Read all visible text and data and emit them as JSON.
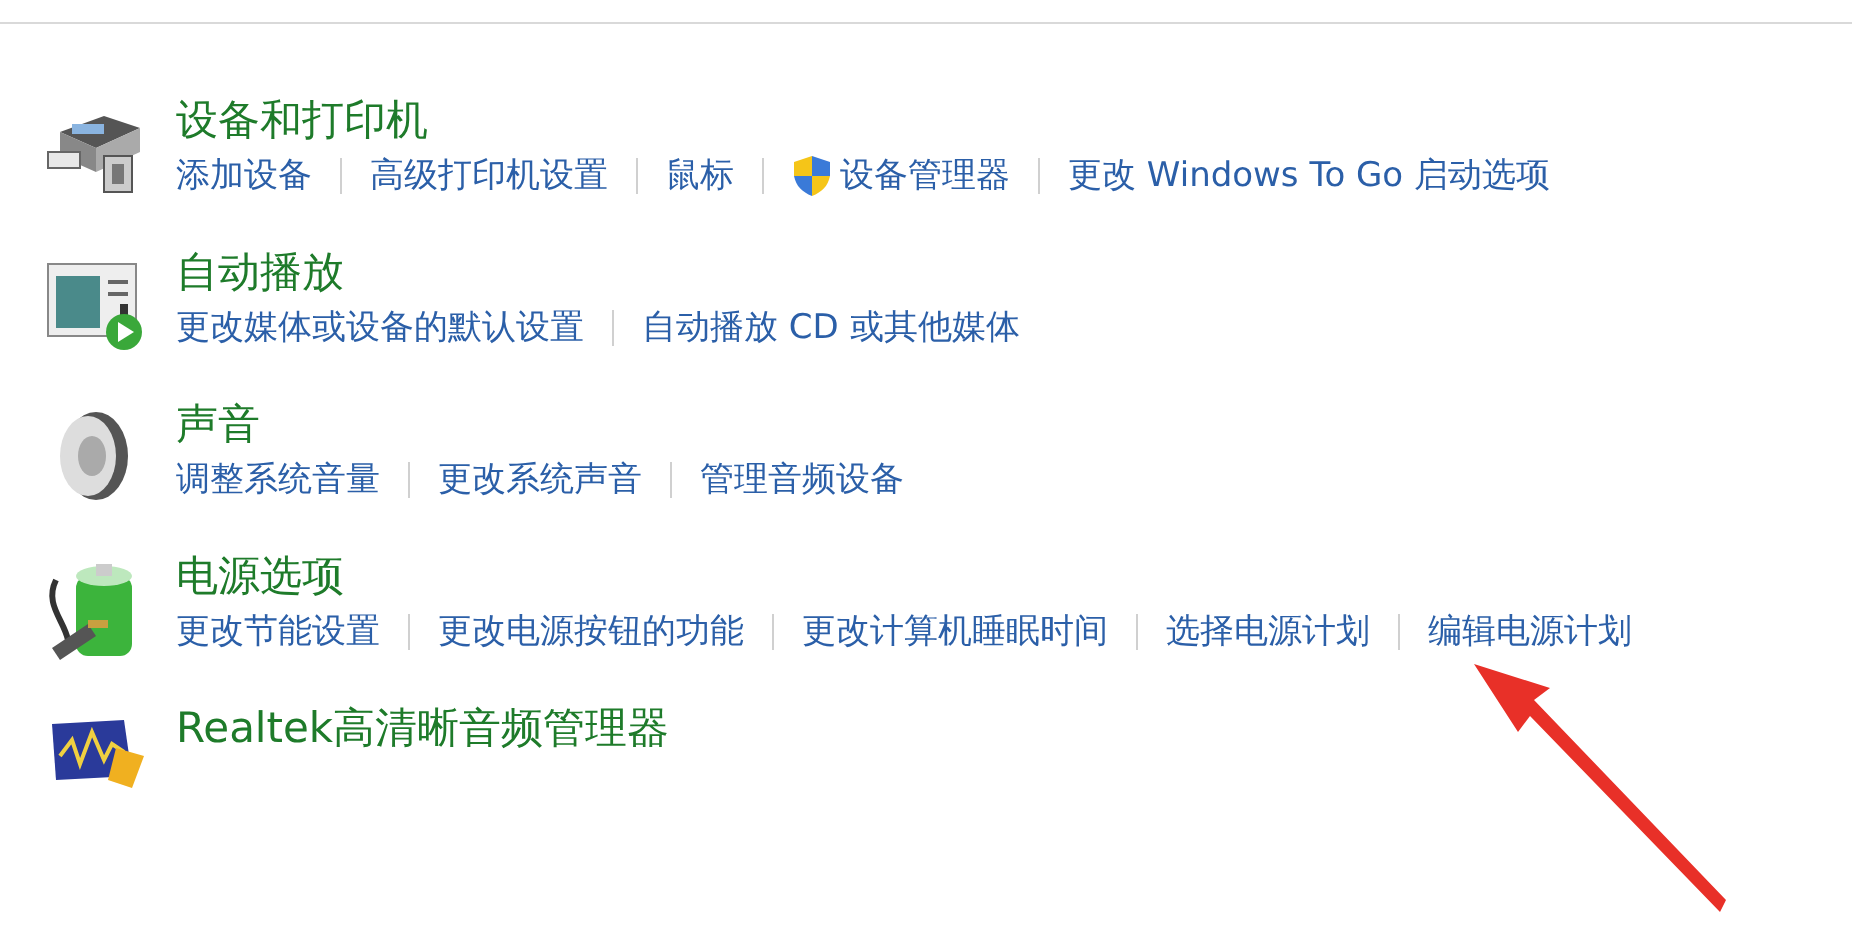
{
  "categories": [
    {
      "title": "设备和打印机",
      "links": [
        {
          "label": "添加设备",
          "shield": false
        },
        {
          "label": "高级打印机设置",
          "shield": false
        },
        {
          "label": "鼠标",
          "shield": false
        },
        {
          "label": "设备管理器",
          "shield": true
        },
        {
          "label": "更改 Windows To Go 启动选项",
          "shield": false
        }
      ]
    },
    {
      "title": "自动播放",
      "links": [
        {
          "label": "更改媒体或设备的默认设置",
          "shield": false
        },
        {
          "label": "自动播放 CD 或其他媒体",
          "shield": false
        }
      ]
    },
    {
      "title": "声音",
      "links": [
        {
          "label": "调整系统音量",
          "shield": false
        },
        {
          "label": "更改系统声音",
          "shield": false
        },
        {
          "label": "管理音频设备",
          "shield": false
        }
      ]
    },
    {
      "title": "电源选项",
      "links": [
        {
          "label": "更改节能设置",
          "shield": false
        },
        {
          "label": "更改电源按钮的功能",
          "shield": false
        },
        {
          "label": "更改计算机睡眠时间",
          "shield": false
        },
        {
          "label": "选择电源计划",
          "shield": false
        },
        {
          "label": "编辑电源计划",
          "shield": false
        }
      ]
    },
    {
      "title": "Realtek高清晰音频管理器"
    }
  ]
}
